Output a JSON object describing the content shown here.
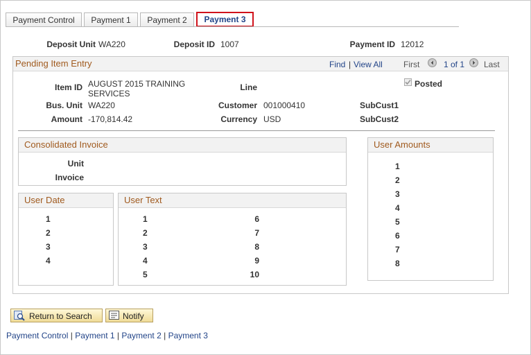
{
  "tabs": [
    "Payment Control",
    "Payment 1",
    "Payment 2",
    "Payment 3"
  ],
  "header": {
    "deposit_unit_label": "Deposit Unit",
    "deposit_unit": "WA220",
    "deposit_id_label": "Deposit ID",
    "deposit_id": "1007",
    "payment_id_label": "Payment ID",
    "payment_id": "12012"
  },
  "pending": {
    "title": "Pending Item Entry",
    "find": "Find",
    "sep": "|",
    "view_all": "View All",
    "first": "First",
    "counter": "1 of 1",
    "last": "Last",
    "item_id_label": "Item ID",
    "item_id_line1": "AUGUST 2015 TRAINING",
    "item_id_line2": "SERVICES",
    "line_label": "Line",
    "posted_label": "Posted",
    "posted": true,
    "bus_unit_label": "Bus. Unit",
    "bus_unit": "WA220",
    "customer_label": "Customer",
    "customer": "001000410",
    "subcust1_label": "SubCust1",
    "amount_label": "Amount",
    "amount": "-170,814.42",
    "currency_label": "Currency",
    "currency": "USD",
    "subcust2_label": "SubCust2"
  },
  "consolidated": {
    "title": "Consolidated Invoice",
    "unit_label": "Unit",
    "invoice_label": "Invoice"
  },
  "user_date": {
    "title": "User Date",
    "rows": [
      "1",
      "2",
      "3",
      "4"
    ]
  },
  "user_text": {
    "title": "User Text",
    "col1": [
      "1",
      "2",
      "3",
      "4",
      "5"
    ],
    "col2": [
      "6",
      "7",
      "8",
      "9",
      "10"
    ]
  },
  "user_amounts": {
    "title": "User Amounts",
    "rows": [
      "1",
      "2",
      "3",
      "4",
      "5",
      "6",
      "7",
      "8"
    ]
  },
  "buttons": {
    "return": "Return to Search",
    "notify": "Notify"
  },
  "footer_links": [
    "Payment Control",
    "Payment 1",
    "Payment 2",
    "Payment 3"
  ],
  "footer_sep": "|"
}
